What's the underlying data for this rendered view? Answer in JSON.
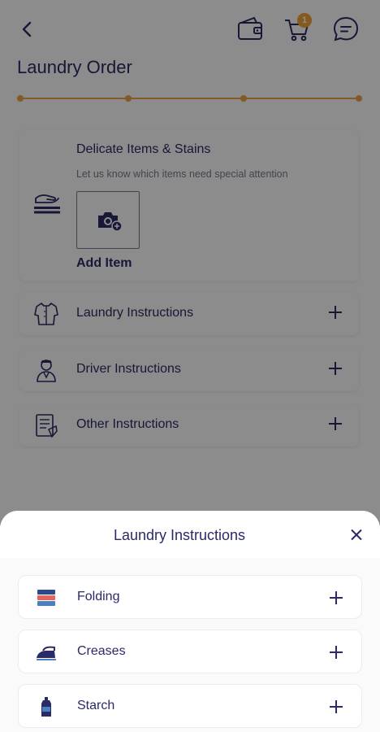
{
  "header": {
    "title": "Laundry Order",
    "cart_badge": "1"
  },
  "colors": {
    "primary": "#2b2a66",
    "accent": "#f0a24a",
    "badge": "#f5a23a"
  },
  "stepper": {
    "steps": 4,
    "current_step": 1
  },
  "delicate": {
    "title": "Delicate Items & Stains",
    "subtitle": "Let us know which items need special attention",
    "add_label": "Add Item"
  },
  "instructions": [
    {
      "label": "Laundry Instructions",
      "icon": "shirt-icon"
    },
    {
      "label": "Driver Instructions",
      "icon": "driver-icon"
    },
    {
      "label": "Other Instructions",
      "icon": "document-icon"
    }
  ],
  "sheet": {
    "title": "Laundry Instructions",
    "options": [
      {
        "label": "Folding",
        "icon": "folded-clothes-icon"
      },
      {
        "label": "Creases",
        "icon": "iron-icon"
      },
      {
        "label": "Starch",
        "icon": "starch-bottle-icon"
      }
    ]
  }
}
